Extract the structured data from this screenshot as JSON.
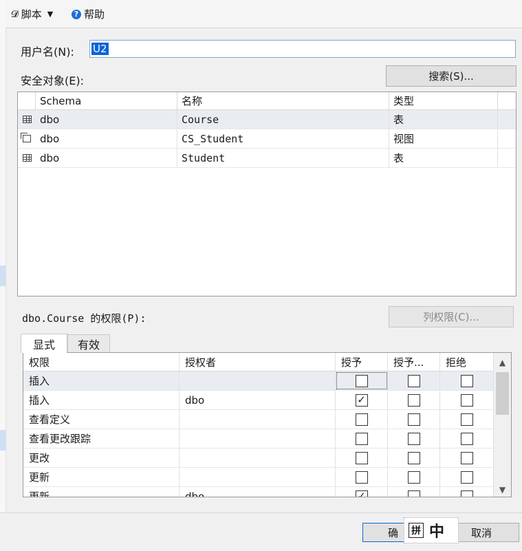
{
  "toolbar": {
    "script_label": "脚本",
    "help_label": "帮助"
  },
  "username": {
    "label": "用户名(N):",
    "value": "U2"
  },
  "securables": {
    "label": "安全对象(E):",
    "search_button": "搜索(S)...",
    "columns": [
      "Schema",
      "名称",
      "类型"
    ],
    "rows": [
      {
        "icon": "table-icon",
        "schema": "dbo",
        "name": "Course",
        "type": "表"
      },
      {
        "icon": "view-icon",
        "schema": "dbo",
        "name": "CS_Student",
        "type": "视图"
      },
      {
        "icon": "table-icon",
        "schema": "dbo",
        "name": "Student",
        "type": "表"
      }
    ]
  },
  "permissions": {
    "label": "dbo.Course 的权限(P):",
    "column_permissions_button": "列权限(C)...",
    "tabs": [
      "显式",
      "有效"
    ],
    "columns": [
      "权限",
      "授权者",
      "授予",
      "授予...",
      "拒绝"
    ],
    "rows": [
      {
        "permission": "插入",
        "grantor": "",
        "grant": false,
        "with_grant": false,
        "deny": false
      },
      {
        "permission": "插入",
        "grantor": "dbo",
        "grant": true,
        "with_grant": false,
        "deny": false
      },
      {
        "permission": "查看定义",
        "grantor": "",
        "grant": false,
        "with_grant": false,
        "deny": false
      },
      {
        "permission": "查看更改跟踪",
        "grantor": "",
        "grant": false,
        "with_grant": false,
        "deny": false
      },
      {
        "permission": "更改",
        "grantor": "",
        "grant": false,
        "with_grant": false,
        "deny": false
      },
      {
        "permission": "更新",
        "grantor": "",
        "grant": false,
        "with_grant": false,
        "deny": false
      },
      {
        "permission": "更新",
        "grantor": "dbo",
        "grant": true,
        "with_grant": false,
        "deny": false
      }
    ]
  },
  "footer": {
    "ok_button": "确",
    "cancel_button": "取消"
  },
  "ime": {
    "pinyin": "拼",
    "mode": "中"
  }
}
